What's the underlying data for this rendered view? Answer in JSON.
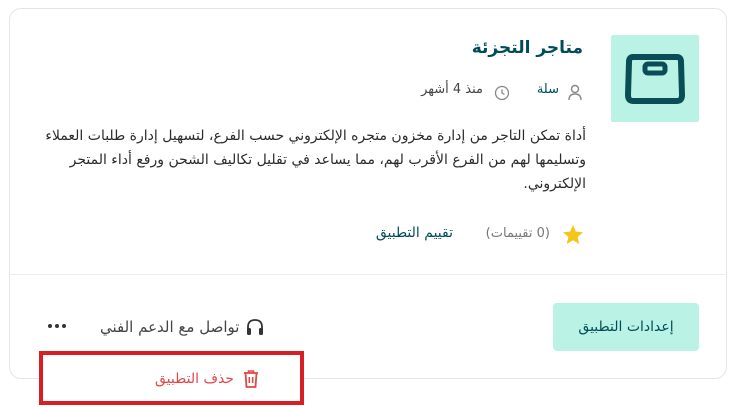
{
  "app": {
    "title": "متاجر التجزئة",
    "category": "سلة",
    "time_ago": "منذ 4 أشهر",
    "description": "أداة تمكن التاجر من إدارة مخزون متجره الإلكتروني حسب الفرع، لتسهيل إدارة طلبات العملاء وتسليمها لهم من الفرع الأقرب لهم، مما يساعد في تقليل تكاليف الشحن ورفع أداء المتجر الإلكتروني.",
    "icon": "scale-icon"
  },
  "rating": {
    "count_text": "(0 تقييمات)",
    "rate_label": "تقييم التطبيق"
  },
  "actions": {
    "settings_label": "إعدادات التطبيق",
    "support_label": "تواصل مع الدعم الفني",
    "delete_label": "حذف التطبيق"
  },
  "colors": {
    "accent_bg": "#baf3e5",
    "brand_dark": "#004d5a",
    "danger": "#e04848",
    "highlight_border": "#d81f26",
    "star": "#f5c518"
  }
}
